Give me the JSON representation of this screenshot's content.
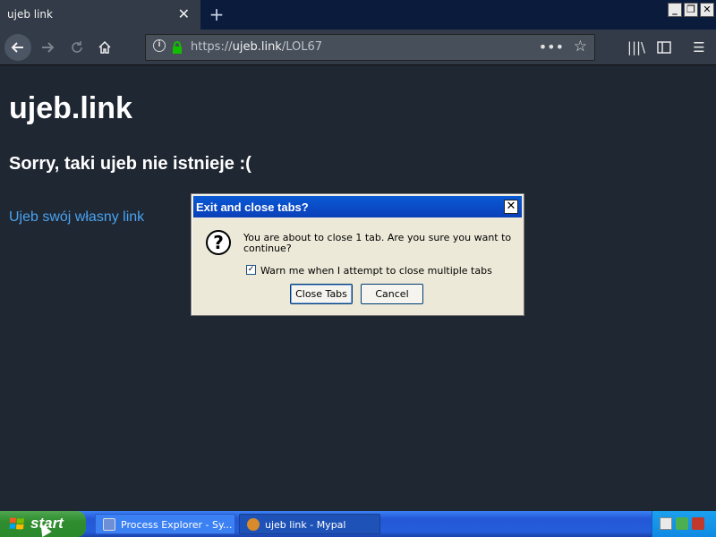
{
  "browser": {
    "tab_title": "ujeb link",
    "tab_close": "✕",
    "new_tab": "+",
    "url_prefix": "https://",
    "url_domain": "ujeb.link",
    "url_path": "/LOL67",
    "window_buttons": [
      "_",
      "❐",
      "✕"
    ],
    "icons": [
      "back-icon",
      "forward-icon",
      "reload-icon",
      "home-icon",
      "info-icon",
      "lock-icon",
      "page-actions-icon",
      "bookmark-star-icon",
      "library-icon",
      "sidebar-icon",
      "menu-icon"
    ]
  },
  "page": {
    "heading": "ujeb.link",
    "subheading": "Sorry, taki ujeb nie istnieje :(",
    "link": "Ujeb swój własny link",
    "background": "#1f2733",
    "link_color": "#4aa3f0"
  },
  "dialog": {
    "title": "Exit and close tabs?",
    "message": "You are about to close 1 tab. Are you sure you want to continue?",
    "checkbox_label": "Warn me when I attempt to close multiple tabs",
    "checkbox_checked": true,
    "primary_button": "Close Tabs",
    "secondary_button": "Cancel"
  },
  "taskbar": {
    "start_label": "start",
    "items": [
      {
        "label": "Process Explorer - Sy..."
      },
      {
        "label": "ujeb link - Mypal"
      }
    ]
  }
}
